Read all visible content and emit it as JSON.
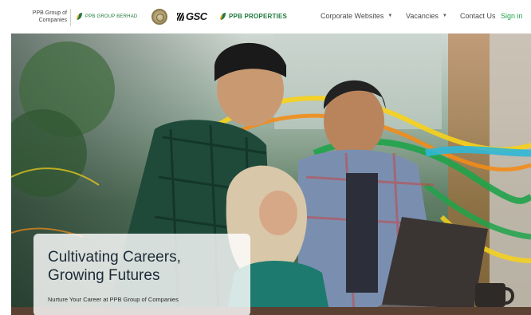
{
  "header": {
    "group_name": "PPB Group of Companies",
    "brands": [
      {
        "name": "PPB GROUP BERHAD",
        "icon": "ppb-leaf-icon"
      },
      {
        "name": "",
        "icon": "seal-icon"
      },
      {
        "name": "GSC",
        "icon": "gsc-logo"
      },
      {
        "name": "PPB PROPERTIES",
        "icon": "ppb-leaf-icon"
      }
    ],
    "nav": {
      "corporate": "Corporate Websites",
      "vacancies": "Vacancies",
      "contact": "Contact Us",
      "signin": "Sign in"
    },
    "caret_icon": "chevron-down-icon"
  },
  "hero": {
    "title": "Cultivating Careers, Growing Futures",
    "subtitle": "Nurture Your Career at PPB Group of Companies"
  },
  "colors": {
    "brand_green": "#1f7a3c",
    "signin_green": "#1fa34a",
    "nav_text": "#4a4a4a",
    "ribbon_colors": [
      "#f7d21a",
      "#f28c1a",
      "#1fa34a",
      "#2fb7d6",
      "#e3471c"
    ]
  }
}
